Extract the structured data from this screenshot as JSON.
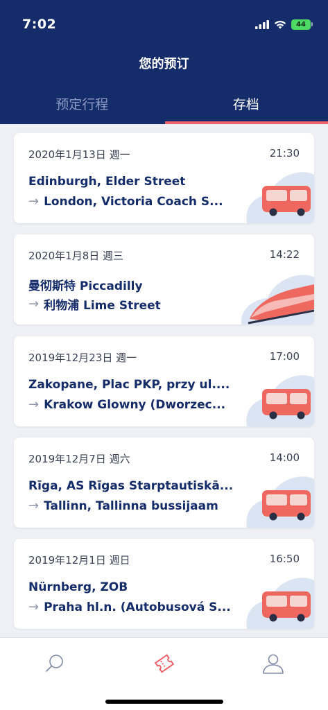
{
  "status_bar": {
    "time": "7:02",
    "battery": "44"
  },
  "header": {
    "title": "您的预订"
  },
  "tabs": [
    {
      "label": "预定行程",
      "active": false
    },
    {
      "label": "存档",
      "active": true
    }
  ],
  "bookings": [
    {
      "date": "2020年1月13日 週一",
      "time": "21:30",
      "from": "Edinburgh, Elder Street",
      "to": "London, Victoria Coach S...",
      "vehicle": "bus-icon"
    },
    {
      "date": "2020年1月8日 週三",
      "time": "14:22",
      "from": "曼彻斯特 Piccadilly",
      "to": "利物浦 Lime Street",
      "vehicle": "train-icon"
    },
    {
      "date": "2019年12月23日 週一",
      "time": "17:00",
      "from": "Zakopane, Plac PKP, przy ul....",
      "to": "Krakow Glowny (Dworzec...",
      "vehicle": "bus-icon"
    },
    {
      "date": "2019年12月7日 週六",
      "time": "14:00",
      "from": "Rīga, AS Rīgas Starptautiskā...",
      "to": "Tallinn, Tallinna bussijaam",
      "vehicle": "bus-icon"
    },
    {
      "date": "2019年12月1日 週日",
      "time": "16:50",
      "from": "Nürnberg, ZOB",
      "to": "Praha hl.n. (Autobusová S...",
      "vehicle": "bus-icon"
    }
  ],
  "bottom_nav": [
    {
      "icon": "search-icon",
      "active": false
    },
    {
      "icon": "ticket-icon",
      "active": true
    },
    {
      "icon": "profile-icon",
      "active": false
    }
  ],
  "colors": {
    "header_bg": "#152c6b",
    "accent": "#f0606a",
    "text_primary": "#152c6b"
  }
}
